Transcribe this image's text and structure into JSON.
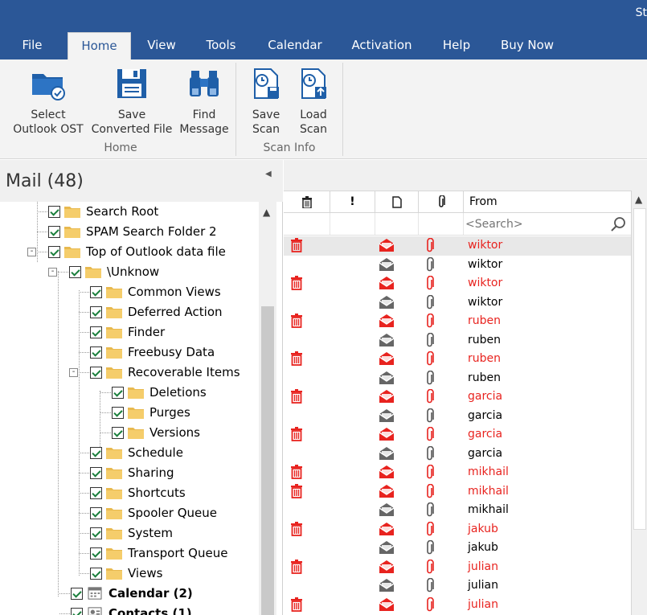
{
  "window": {
    "title_fragment": "St"
  },
  "menu": {
    "tabs": [
      {
        "label": "File"
      },
      {
        "label": "Home"
      },
      {
        "label": "View"
      },
      {
        "label": "Tools"
      },
      {
        "label": "Calendar"
      },
      {
        "label": "Activation"
      },
      {
        "label": "Help"
      },
      {
        "label": "Buy Now"
      }
    ],
    "active": "Home"
  },
  "ribbon": {
    "home_group": {
      "label": "Home",
      "buttons": [
        {
          "line1": "Select",
          "line2": "Outlook OST",
          "icon": "folder-check-icon"
        },
        {
          "line1": "Save",
          "line2": "Converted File",
          "icon": "floppy-disk-icon"
        },
        {
          "line1": "Find",
          "line2": "Message",
          "icon": "binoculars-icon"
        }
      ]
    },
    "scan_group": {
      "label": "Scan Info",
      "buttons": [
        {
          "line1": "Save",
          "line2": "Scan",
          "icon": "save-scan-icon"
        },
        {
          "line1": "Load",
          "line2": "Scan",
          "icon": "load-scan-icon"
        }
      ]
    }
  },
  "left_pane": {
    "title": "Mail (48)",
    "tree": [
      {
        "label": "Search Root"
      },
      {
        "label": "SPAM Search Folder 2"
      },
      {
        "label": "Top of Outlook data file"
      },
      {
        "label": "\\Unknow"
      },
      {
        "label": "Common Views"
      },
      {
        "label": "Deferred Action"
      },
      {
        "label": "Finder"
      },
      {
        "label": "Freebusy Data"
      },
      {
        "label": "Recoverable Items"
      },
      {
        "label": "Deletions"
      },
      {
        "label": "Purges"
      },
      {
        "label": "Versions"
      },
      {
        "label": "Schedule"
      },
      {
        "label": "Sharing"
      },
      {
        "label": "Shortcuts"
      },
      {
        "label": "Spooler Queue"
      },
      {
        "label": "System"
      },
      {
        "label": "Transport Queue"
      },
      {
        "label": "Views"
      },
      {
        "label": "Calendar (2)"
      },
      {
        "label": "Contacts (1)"
      }
    ]
  },
  "message_list": {
    "columns": {
      "delete": "trash-icon",
      "importance": "!",
      "type": "document-icon",
      "attachment": "paperclip-icon",
      "from": "From"
    },
    "search_placeholder": "<Search>",
    "colors": {
      "deleted": "#e8231f",
      "normal": "#000000"
    },
    "rows": [
      {
        "from": "wiktor",
        "deleted": true
      },
      {
        "from": "wiktor",
        "deleted": false
      },
      {
        "from": "wiktor",
        "deleted": true
      },
      {
        "from": "wiktor",
        "deleted": false
      },
      {
        "from": "ruben",
        "deleted": true
      },
      {
        "from": "ruben",
        "deleted": false
      },
      {
        "from": "ruben",
        "deleted": true
      },
      {
        "from": "ruben",
        "deleted": false
      },
      {
        "from": "garcia",
        "deleted": true
      },
      {
        "from": "garcia",
        "deleted": false
      },
      {
        "from": "garcia",
        "deleted": true
      },
      {
        "from": "garcia",
        "deleted": false
      },
      {
        "from": "mikhail",
        "deleted": true
      },
      {
        "from": "mikhail",
        "deleted": true
      },
      {
        "from": "mikhail",
        "deleted": false
      },
      {
        "from": "jakub",
        "deleted": true
      },
      {
        "from": "jakub",
        "deleted": false
      },
      {
        "from": "julian",
        "deleted": true
      },
      {
        "from": "julian",
        "deleted": false
      },
      {
        "from": "julian",
        "deleted": true
      }
    ]
  }
}
